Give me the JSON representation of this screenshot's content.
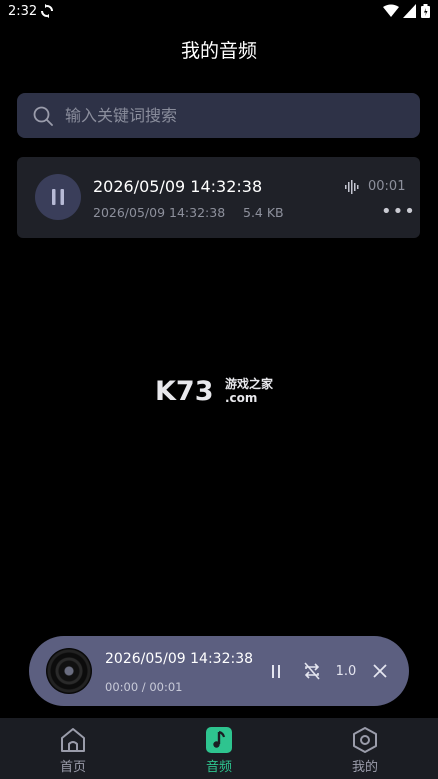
{
  "status_bar": {
    "time": "2:32"
  },
  "page": {
    "title": "我的音频"
  },
  "search": {
    "placeholder": "输入关键词搜索",
    "value": ""
  },
  "audio_list": [
    {
      "title": "2026/05/09 14:32:38",
      "date": "2026/05/09 14:32:38",
      "size": "5.4 KB",
      "duration": "00:01",
      "state": "playing"
    }
  ],
  "watermark": {
    "brand": "K73",
    "cn": "游戏之家",
    "domain": ".com"
  },
  "mini_player": {
    "title": "2026/05/09 14:32:38",
    "time": "00:00 / 00:01",
    "speed": "1.0"
  },
  "bottom_nav": {
    "items": [
      {
        "label": "首页",
        "icon": "home-icon"
      },
      {
        "label": "音频",
        "icon": "music-note-icon",
        "active": true
      },
      {
        "label": "我的",
        "icon": "hexagon-profile-icon"
      }
    ]
  },
  "colors": {
    "accent": "#2ec48f",
    "card": "#1f2128",
    "search": "#2e3247",
    "player": "#5c5f80",
    "nav": "#1b1d23"
  }
}
